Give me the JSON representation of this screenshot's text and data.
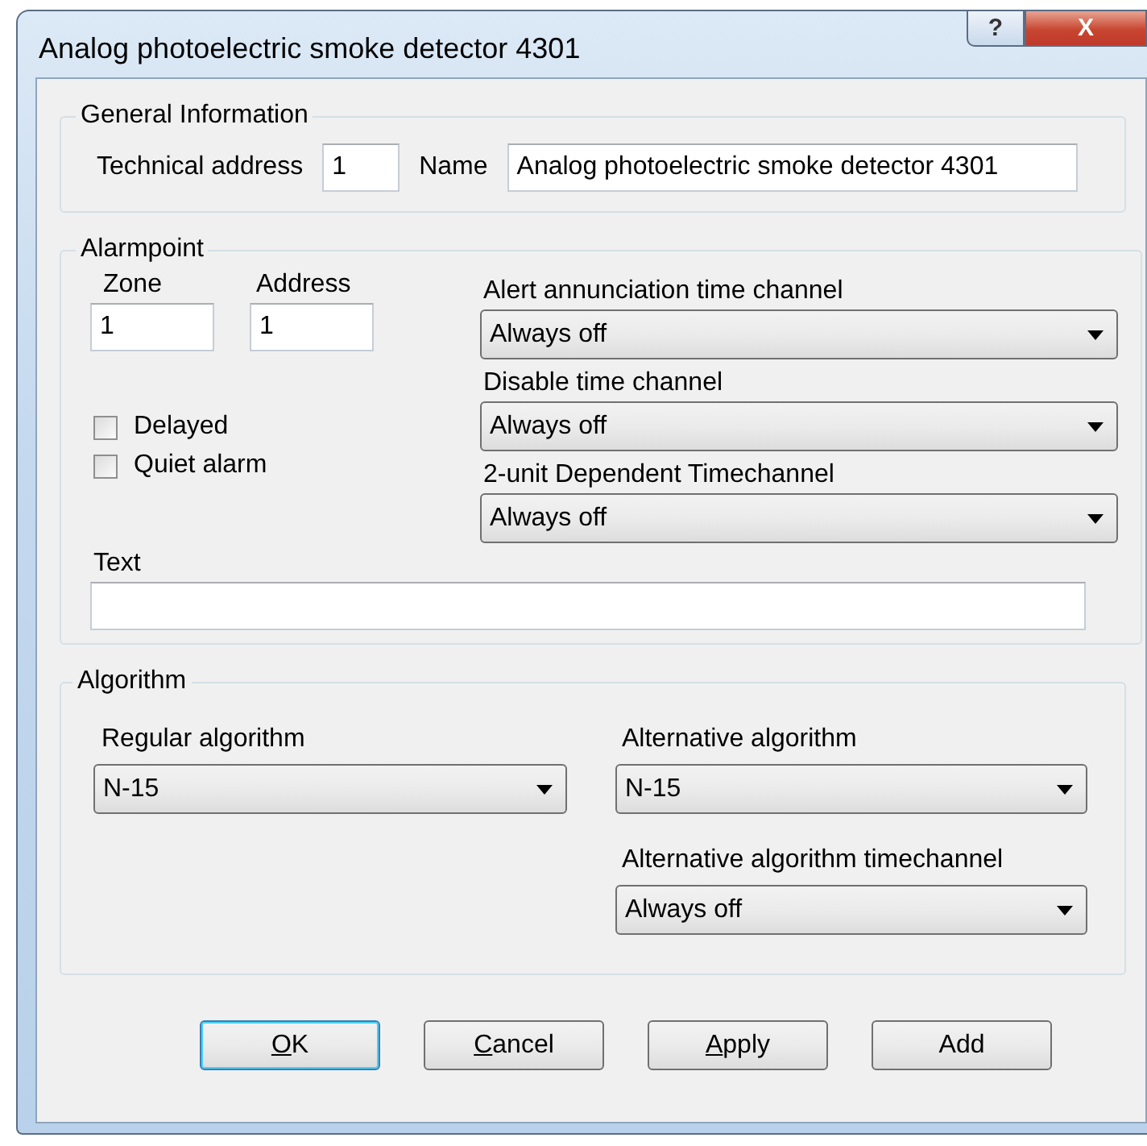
{
  "window": {
    "title": "Analog photoelectric smoke detector 4301",
    "buttons": [
      {
        "kind": "help",
        "label": "?"
      },
      {
        "kind": "close",
        "label": "X"
      }
    ]
  },
  "general": {
    "title": "General Information",
    "technical_address": {
      "label": "Technical address",
      "value": "1"
    },
    "name": {
      "label": "Name",
      "value": "Analog photoelectric smoke detector 4301"
    }
  },
  "alarmpoint": {
    "title": "Alarmpoint",
    "zone": {
      "label": "Zone",
      "value": "1"
    },
    "address": {
      "label": "Address",
      "value": "1"
    },
    "checkboxes": [
      {
        "label": "Delayed",
        "checked": false
      },
      {
        "label": "Quiet alarm",
        "checked": false
      }
    ],
    "text": {
      "label": "Text"
    },
    "combos": [
      {
        "label": "Alert annunciation time channel",
        "value": "Always off"
      },
      {
        "label": "Disable time channel",
        "value": "Always off"
      },
      {
        "label": "2-unit Dependent Timechannel",
        "value": "Always off"
      }
    ]
  },
  "algorithm": {
    "title": "Algorithm",
    "regular": {
      "label": "Regular algorithm",
      "value": "N-15"
    },
    "alternative": [
      {
        "label": "Alternative algorithm",
        "value": "N-15"
      },
      {
        "label": "Alternative algorithm timechannel",
        "value": "Always off"
      }
    ]
  },
  "buttons": [
    {
      "label": "OK",
      "underline_first": true,
      "default": true
    },
    {
      "label": "Cancel",
      "underline_first": true,
      "default": false
    },
    {
      "label": "Apply",
      "underline_first": true,
      "default": false
    },
    {
      "label": "Add",
      "underline_first": false,
      "default": false
    }
  ]
}
